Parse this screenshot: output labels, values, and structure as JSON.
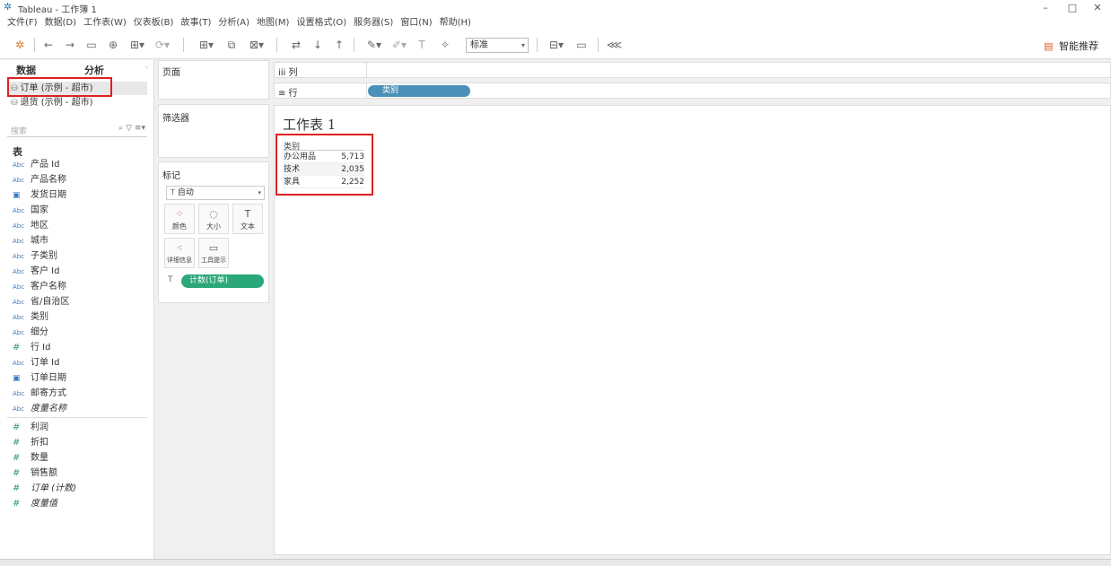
{
  "window": {
    "title": "Tableau - 工作簿 1",
    "minimize": "–",
    "maximize": "□",
    "close": "✕"
  },
  "menu": [
    "文件(F)",
    "数据(D)",
    "工作表(W)",
    "仪表板(B)",
    "故事(T)",
    "分析(A)",
    "地图(M)",
    "设置格式(O)",
    "服务器(S)",
    "窗口(N)",
    "帮助(H)"
  ],
  "toolbar": {
    "fit_select": "标准",
    "smart_label": "智能推荐"
  },
  "left_pane": {
    "tab_data": "数据",
    "tab_analysis": "分析",
    "datasources": [
      {
        "label": "订单 (示例 - 超市)",
        "selected": true
      },
      {
        "label": "退货 (示例 - 超市)",
        "selected": false
      }
    ],
    "search_placeholder": "搜索",
    "section_table": "表",
    "dimensions": [
      {
        "type": "Abc",
        "label": "产品 Id"
      },
      {
        "type": "Abc",
        "label": "产品名称"
      },
      {
        "type": "date",
        "label": "发货日期"
      },
      {
        "type": "Abc",
        "label": "国家"
      },
      {
        "type": "Abc",
        "label": "地区"
      },
      {
        "type": "Abc",
        "label": "城市"
      },
      {
        "type": "Abc",
        "label": "子类别"
      },
      {
        "type": "Abc",
        "label": "客户 Id"
      },
      {
        "type": "Abc",
        "label": "客户名称"
      },
      {
        "type": "Abc",
        "label": "省/自治区"
      },
      {
        "type": "Abc",
        "label": "类别"
      },
      {
        "type": "Abc",
        "label": "细分"
      },
      {
        "type": "#",
        "label": "行 Id"
      },
      {
        "type": "Abc",
        "label": "订单 Id"
      },
      {
        "type": "date",
        "label": "订单日期"
      },
      {
        "type": "Abc",
        "label": "邮寄方式"
      },
      {
        "type": "Abc",
        "label": "度量名称",
        "italic": true
      }
    ],
    "measures": [
      {
        "type": "#",
        "label": "利润"
      },
      {
        "type": "#",
        "label": "折扣"
      },
      {
        "type": "#",
        "label": "数量"
      },
      {
        "type": "#",
        "label": "销售额"
      },
      {
        "type": "#",
        "label": "订单 (计数)",
        "italic": true
      },
      {
        "type": "#",
        "label": "度量值",
        "italic": true
      }
    ]
  },
  "shelves": {
    "pages": "页面",
    "filters": "筛选器",
    "marks": "标记",
    "mark_type": "自动",
    "mark_buttons": [
      {
        "label": "颜色",
        "icon": "color-icon"
      },
      {
        "label": "大小",
        "icon": "size-icon"
      },
      {
        "label": "文本",
        "icon": "text-icon"
      },
      {
        "label": "详细信息",
        "icon": "detail-icon"
      },
      {
        "label": "工具提示",
        "icon": "tooltip-icon"
      }
    ],
    "mark_pill": "计数(订单)",
    "columns_label": "iii 列",
    "rows_label": "≡ 行",
    "rows_pill": "类别"
  },
  "worksheet": {
    "title": "工作表 1",
    "table_header": "类别",
    "rows": [
      {
        "category": "办公用品",
        "value": "5,713"
      },
      {
        "category": "技术",
        "value": "2,035"
      },
      {
        "category": "家具",
        "value": "2,252"
      }
    ]
  },
  "colors": {
    "highlight": "#e02020",
    "dimension_pill": "#4a90b8",
    "measure_pill": "#2aa87a"
  }
}
